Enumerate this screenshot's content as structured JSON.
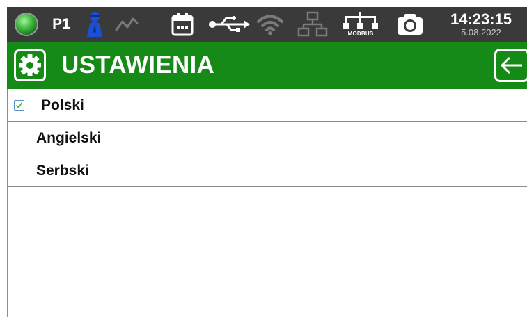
{
  "status_bar": {
    "led_color": "#3cb83c",
    "profile": "P1",
    "user_icon_color": "#1a4fd6",
    "modbus_label": "MODBUS",
    "time": "14:23:15",
    "date": "5.08.2022",
    "icons": [
      "status-led-icon",
      "user-icon",
      "trend-icon",
      "calendar-icon",
      "usb-icon",
      "wifi-icon",
      "network-icon",
      "modbus-icon",
      "camera-icon"
    ]
  },
  "header": {
    "title": "USTAWIENIA",
    "background": "#168a16",
    "icon": "settings-gear-icon",
    "back_icon": "back-arrow-icon"
  },
  "languages": [
    {
      "label": "Polski",
      "selected": true
    },
    {
      "label": "Angielski",
      "selected": false
    },
    {
      "label": "Serbski",
      "selected": false
    }
  ]
}
